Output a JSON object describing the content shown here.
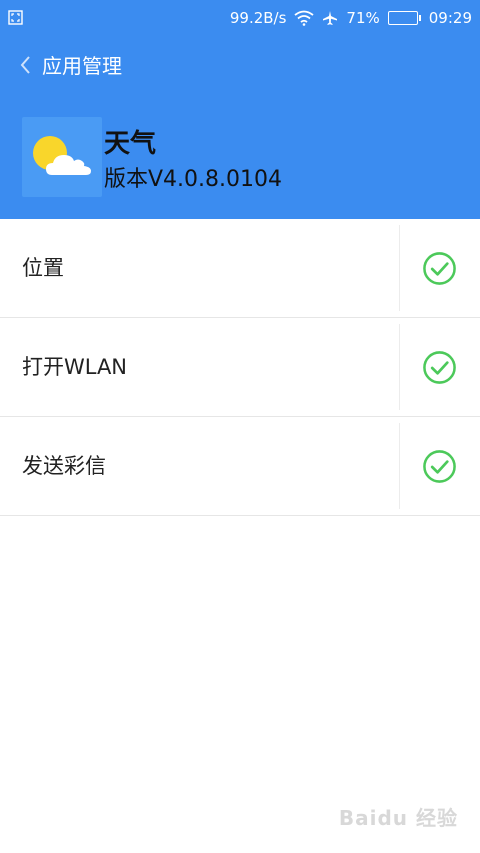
{
  "status_bar": {
    "net_speed": "99.2B/s",
    "battery_percent": "71%",
    "battery_level": 0.71,
    "time": "09:29",
    "icons": [
      "screenshot-icon",
      "wifi-icon",
      "airplane-icon",
      "battery-icon"
    ]
  },
  "nav": {
    "title": "应用管理",
    "back_icon": "chevron-left-icon"
  },
  "app": {
    "name": "天气",
    "version": "版本V4.0.8.0104",
    "icon": "weather-sun-cloud-icon"
  },
  "permissions": [
    {
      "label": "位置",
      "granted": true
    },
    {
      "label": "打开WLAN",
      "granted": true
    },
    {
      "label": "发送彩信",
      "granted": true
    }
  ],
  "colors": {
    "header_bg": "#3b8cf0",
    "check_green": "#4cc95a"
  },
  "watermark": "Baidu 经验"
}
